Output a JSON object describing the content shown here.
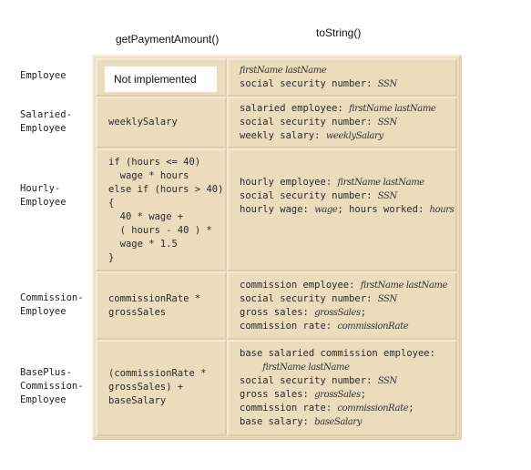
{
  "columns": {
    "payment": "getPaymentAmount()",
    "tostring": "toString()"
  },
  "rows": [
    {
      "label": "Employee",
      "payment": "Not implemented",
      "tostring": [
        [
          {
            "t": "firstName lastName",
            "i": true
          }
        ],
        [
          {
            "t": "social security number: "
          },
          {
            "t": "SSN",
            "i": true
          }
        ]
      ]
    },
    {
      "label": "Salaried-\nEmployee",
      "payment": "weeklySalary",
      "tostring": [
        [
          {
            "t": "salaried employee: "
          },
          {
            "t": "firstName lastName",
            "i": true
          }
        ],
        [
          {
            "t": "social security number: "
          },
          {
            "t": "SSN",
            "i": true
          }
        ],
        [
          {
            "t": "weekly salary: "
          },
          {
            "t": "weeklySalary",
            "i": true
          }
        ]
      ]
    },
    {
      "label": "Hourly-\nEmployee",
      "payment": "if (hours <= 40)\n  wage * hours\nelse if (hours > 40)\n{\n  40 * wage +\n  ( hours - 40 ) *\n  wage * 1.5\n}",
      "tostring": [
        [
          {
            "t": "hourly employee: "
          },
          {
            "t": "firstName lastName",
            "i": true
          }
        ],
        [
          {
            "t": "social security number: "
          },
          {
            "t": "SSN",
            "i": true
          }
        ],
        [
          {
            "t": "hourly wage: "
          },
          {
            "t": "wage",
            "i": true
          },
          {
            "t": "; hours worked: "
          },
          {
            "t": "hours",
            "i": true
          }
        ]
      ]
    },
    {
      "label": "Commission-\nEmployee",
      "payment": "commissionRate *\ngrossSales",
      "tostring": [
        [
          {
            "t": "commission employee: "
          },
          {
            "t": "firstName lastName",
            "i": true
          }
        ],
        [
          {
            "t": "social security number: "
          },
          {
            "t": "SSN",
            "i": true
          }
        ],
        [
          {
            "t": "gross sales: "
          },
          {
            "t": "grossSales",
            "i": true
          },
          {
            "t": ";"
          }
        ],
        [
          {
            "t": "commission rate: "
          },
          {
            "t": "commissionRate",
            "i": true
          }
        ]
      ]
    },
    {
      "label": "BasePlus-\nCommission-\nEmployee",
      "payment": "(commissionRate *\ngrossSales) +\nbaseSalary",
      "tostring": [
        [
          {
            "t": "base salaried commission employee:"
          }
        ],
        [
          {
            "t": "    "
          },
          {
            "t": "firstName lastName",
            "i": true
          }
        ],
        [
          {
            "t": "social security number: "
          },
          {
            "t": "SSN",
            "i": true
          }
        ],
        [
          {
            "t": "gross sales: "
          },
          {
            "t": "grossSales",
            "i": true
          },
          {
            "t": ";"
          }
        ],
        [
          {
            "t": "commission rate: "
          },
          {
            "t": "commissionRate",
            "i": true
          },
          {
            "t": ";"
          }
        ],
        [
          {
            "t": "base salary: "
          },
          {
            "t": "baseSalary",
            "i": true
          }
        ]
      ]
    }
  ]
}
